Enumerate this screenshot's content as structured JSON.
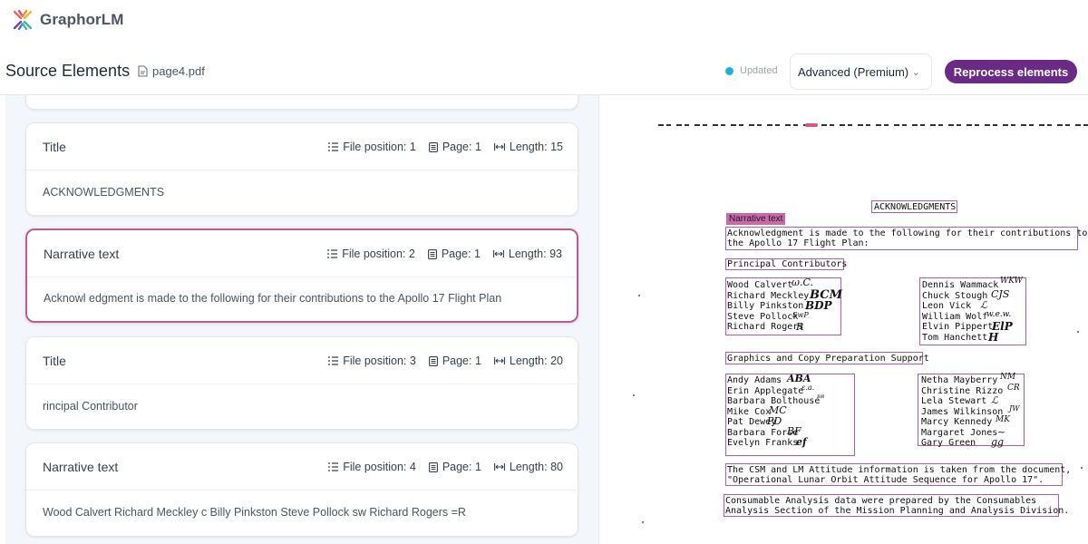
{
  "app": {
    "name": "GraphorLM"
  },
  "header": {
    "title": "Source Elements",
    "file_name": "page4.pdf",
    "status": "Updated",
    "parser_select": "Advanced (Premium)",
    "reprocess_label": "Reprocess elements"
  },
  "elements": [
    {
      "type": "Title",
      "file_position_label": "File position: 1",
      "page_label": "Page: 1",
      "length_label": "Length: 15",
      "text": "ACKNOWLEDGMENTS"
    },
    {
      "type": "Narrative text",
      "file_position_label": "File position: 2",
      "page_label": "Page: 1",
      "length_label": "Length: 93",
      "text": "Acknowl edgment is made to the following for their contributions to the Apollo 17 Flight Plan"
    },
    {
      "type": "Title",
      "file_position_label": "File position: 3",
      "page_label": "Page: 1",
      "length_label": "Length: 20",
      "text": "rincipal Contributor"
    },
    {
      "type": "Narrative text",
      "file_position_label": "File position: 4",
      "page_label": "Page: 1",
      "length_label": "Length: 80",
      "text": "Wood Calvert Richard Meckley c Billy Pinkston Steve Pollock sw Richard Rogers =R"
    }
  ],
  "document": {
    "heading": "ACKNOWLEDGMENTS",
    "highlight_tag": "Narrative text",
    "intro_line1": "Acknowledgment is made to the following for their contributions to",
    "intro_line2": "the Apollo 17 Flight Plan:",
    "principal_heading": "Principal Contributors",
    "principal_left": [
      "Wood Calvert",
      "Richard Meckley",
      "Billy Pinkston",
      "Steve Pollock",
      "Richard Rogers"
    ],
    "principal_right": [
      "Dennis Wammack",
      "Chuck Stough",
      "Leon Vick",
      "William Wolf",
      "Elvin Pippert",
      "Tom Hanchett"
    ],
    "graphics_heading": "Graphics and Copy Preparation Support",
    "graphics_left": [
      "Andy Adams",
      "Erin Applegate",
      "Barbara Bolthouse",
      "Mike Cox",
      "Pat Dewey",
      "Barbara Forse",
      "Evelyn Franks"
    ],
    "graphics_right": [
      "Netha Mayberry",
      "Christine Rizzo",
      "Lela Stewart",
      "James Wilkinson",
      "Marcy Kennedy",
      "Margaret Jones",
      "Gary Green"
    ],
    "csm_line1": "The CSM and LM Attitude information is taken from the document,",
    "csm_line2": "\"Operational Lunar Orbit Attitude Sequence for Apollo 17\".",
    "consumable_line1": "Consumable Analysis data were prepared by the Consumables",
    "consumable_line2": "Analysis Section of the Mission Planning and Analysis Division."
  },
  "colors": {
    "accent": "#6b2a86",
    "selection": "#b85c9b",
    "status_dot": "#22b2d8"
  }
}
